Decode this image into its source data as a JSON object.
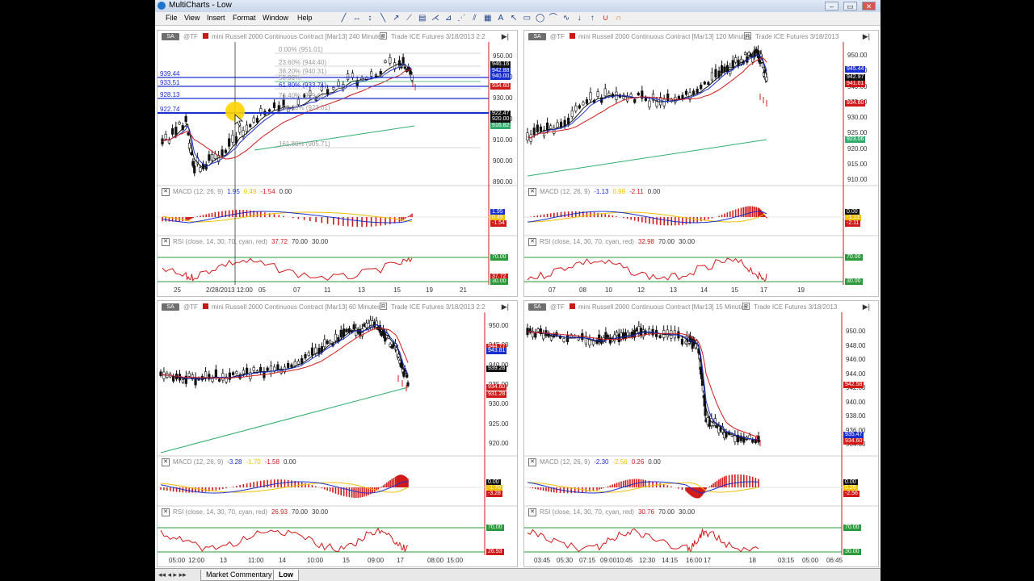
{
  "window": {
    "title": "MultiCharts - Low",
    "controls": [
      "–",
      "▭",
      "✕"
    ]
  },
  "menu": [
    "File",
    "View",
    "Insert",
    "Format",
    "Window",
    "Help"
  ],
  "toolbar_icons": [
    "line-tool-icon",
    "horizontal-line-icon",
    "vertical-line-icon",
    "trendline-icon",
    "ray-icon",
    "fibonacci-icon",
    "channel-icon",
    "andrews-icon",
    "gann-icon",
    "speed-lines-icon",
    "regression-icon",
    "grid-icon",
    "text-icon",
    "arrow-icon",
    "rectangle-icon",
    "ellipse-icon",
    "arc-icon",
    "freehand-icon",
    "down-arrow-icon",
    "up-arrow-icon",
    "magnet-icon",
    "magnet-snap-icon"
  ],
  "charts": [
    {
      "id": "c1",
      "sa": "SA",
      "symbol": "@TF",
      "description": "mini Russell 2000 Continuous Contract [Mar13] 240 Minutes",
      "exchange": "Trade  ICE  Futures  3/18/2013  2:2",
      "price_axis": [
        "950.00",
        "940.00",
        "930.00",
        "920.00",
        "910.00",
        "900.00",
        "890.00"
      ],
      "fib_levels": [
        "0.00% (951.01)",
        "23.60% (944.40)",
        "38.20% (940.31)",
        "50.00%",
        "61.80% (933.71)",
        "76.40% (929.62)",
        "100.00% (923.01)",
        "161.80% (905.71)"
      ],
      "hlines": [
        "939.44",
        "933.51",
        "928.13",
        "922.74"
      ],
      "price_boxes": [
        {
          "v": "946.16",
          "c": "#111"
        },
        {
          "v": "942.88",
          "c": "#1a2fd0"
        },
        {
          "v": "940.00",
          "c": "#1a2fd0"
        },
        {
          "v": "934.60",
          "c": "#d01a1a"
        },
        {
          "v": "922.47",
          "c": "#111"
        },
        {
          "v": "920.00",
          "c": "#111"
        },
        {
          "v": "916.82",
          "c": "#2eae6c"
        }
      ],
      "macd": {
        "label": "MACD (12, 26, 9)",
        "v1": "1.95",
        "v2": "0.49",
        "v3": "-1.54",
        "v4": "0.00",
        "boxes": [
          "1.95",
          "0.49",
          "-1.54"
        ]
      },
      "rsi": {
        "label": "RSI (close, 14, 30, 70, cyan, red)",
        "v1": "37.72",
        "v2": "70.00",
        "v3": "30.00",
        "boxes": [
          "70.00",
          "37.72",
          "30.00"
        ]
      },
      "time_axis": [
        "25",
        "2/28/2013 12:00",
        "05",
        "07",
        "11",
        "13",
        "15",
        "19",
        "21"
      ]
    },
    {
      "id": "c2",
      "sa": "SA",
      "symbol": "@TF",
      "description": "mini Russell 2000 Continuous Contract [Mar13] 120 Minutes",
      "exchange": "Trade  ICE  Futures  3/18/2013",
      "price_axis": [
        "950.00",
        "945.00",
        "940.00",
        "935.00",
        "930.00",
        "925.00",
        "920.00",
        "915.00",
        "910.00"
      ],
      "price_boxes": [
        {
          "v": "945.44",
          "c": "#1a2fd0"
        },
        {
          "v": "942.97",
          "c": "#111"
        },
        {
          "v": "941.01",
          "c": "#d01a1a"
        },
        {
          "v": "934.60",
          "c": "#d01a1a"
        },
        {
          "v": "923.06",
          "c": "#2eae6c"
        }
      ],
      "macd": {
        "label": "MACD (12, 26, 9)",
        "v1": "-1.13",
        "v2": "0.98",
        "v3": "-2.11",
        "v4": "0.00",
        "boxes": [
          "0.00",
          "-1.13",
          "-2.11"
        ]
      },
      "rsi": {
        "label": "RSI (close, 14, 30, 70, cyan, red)",
        "v1": "32.98",
        "v2": "70.00",
        "v3": "30.00",
        "boxes": [
          "70.00",
          "30.00"
        ]
      },
      "time_axis": [
        "07",
        "08",
        "10",
        "12",
        "13",
        "14",
        "15",
        "17",
        "19"
      ]
    },
    {
      "id": "c3",
      "sa": "SA",
      "symbol": "@TF",
      "description": "mini Russell 2000 Continuous Contract [Mar13] 60 Minutes",
      "exchange": "Trade  ICE  Futures  3/18/2013  2:2",
      "price_axis": [
        "950.00",
        "945.00",
        "940.00",
        "935.00",
        "930.00",
        "925.00",
        "920.00"
      ],
      "price_boxes": [
        {
          "v": "944.77",
          "c": "#d01a1a"
        },
        {
          "v": "943.81",
          "c": "#1a2fd0"
        },
        {
          "v": "939.28",
          "c": "#111"
        },
        {
          "v": "934.60",
          "c": "#d01a1a"
        },
        {
          "v": "931.28",
          "c": "#d01a1a"
        }
      ],
      "macd": {
        "label": "MACD (12, 26, 9)",
        "v1": "-3.28",
        "v2": "-1.70",
        "v3": "-1.58",
        "v4": "0.00",
        "boxes": [
          "0.00",
          "-1.70",
          "-3.28"
        ]
      },
      "rsi": {
        "label": "RSI (close, 14, 30, 70, cyan, red)",
        "v1": "26.93",
        "v2": "70.00",
        "v3": "30.00",
        "boxes": [
          "70.00",
          "26.93"
        ]
      },
      "time_axis": [
        "05:00",
        "12:00",
        "13",
        "11:00",
        "14",
        "10:00",
        "15",
        "09:00",
        "17",
        "08:00",
        "15:00"
      ]
    },
    {
      "id": "c4",
      "sa": "SA",
      "symbol": "@TF",
      "description": "mini Russell 2000 Continuous Contract [Mar13] 15 Minutes",
      "exchange": "Trade  ICE  Futures  3/18/2013",
      "price_axis": [
        "950.00",
        "948.00",
        "946.00",
        "944.00",
        "942.00",
        "940.00",
        "938.00",
        "936.00",
        "934.00"
      ],
      "price_boxes": [
        {
          "v": "942.58",
          "c": "#d01a1a"
        },
        {
          "v": "935.47",
          "c": "#1a2fd0"
        },
        {
          "v": "934.60",
          "c": "#d01a1a"
        }
      ],
      "macd": {
        "label": "MACD (12, 26, 9)",
        "v1": "-2.30",
        "v2": "-2.56",
        "v3": "0.26",
        "v4": "0.00",
        "boxes": [
          "0.00",
          "0.26",
          "-2.56"
        ]
      },
      "rsi": {
        "label": "RSI (close, 14, 30, 70, cyan, red)",
        "v1": "30.76",
        "v2": "70.00",
        "v3": "30.00",
        "boxes": [
          "70.00",
          "30.00"
        ]
      },
      "time_axis": [
        "03:45",
        "05:30",
        "07:15",
        "09:00",
        "10:45",
        "12:30",
        "14:15",
        "16:00",
        "17",
        "18",
        "03:15",
        "05:00",
        "06:45"
      ]
    }
  ],
  "tabs": [
    "Market Commentary",
    "Low"
  ],
  "colors": {
    "blue_line": "#1a2fd0",
    "red_line": "#d01a1a",
    "green_line": "#2eae6c",
    "black_line": "#111111",
    "macd_signal": "#f0c000",
    "bar_pos": "#d01a1a",
    "rsi_line": "#d01a1a",
    "rsi_band": "#2a9a3a"
  }
}
